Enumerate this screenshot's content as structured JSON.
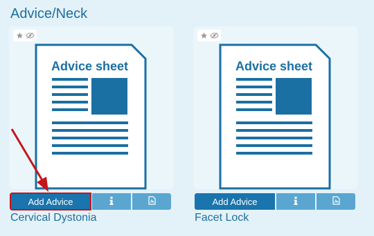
{
  "page": {
    "title": "Advice/Neck"
  },
  "cards": [
    {
      "sheet_heading": "Advice sheet",
      "add_label": "Add Advice",
      "info_icon": "info-icon",
      "pdf_icon": "pdf-icon",
      "title": "Cervical Dystonia",
      "highlighted": true
    },
    {
      "sheet_heading": "Advice sheet",
      "add_label": "Add Advice",
      "info_icon": "info-icon",
      "pdf_icon": "pdf-icon",
      "title": "Facet Lock",
      "highlighted": false
    }
  ],
  "colors": {
    "accent": "#1a74ad",
    "accent_light": "#5aa6d1",
    "title": "#1d6e9e",
    "highlight": "#c4161c",
    "background": "#e3f2f9"
  }
}
